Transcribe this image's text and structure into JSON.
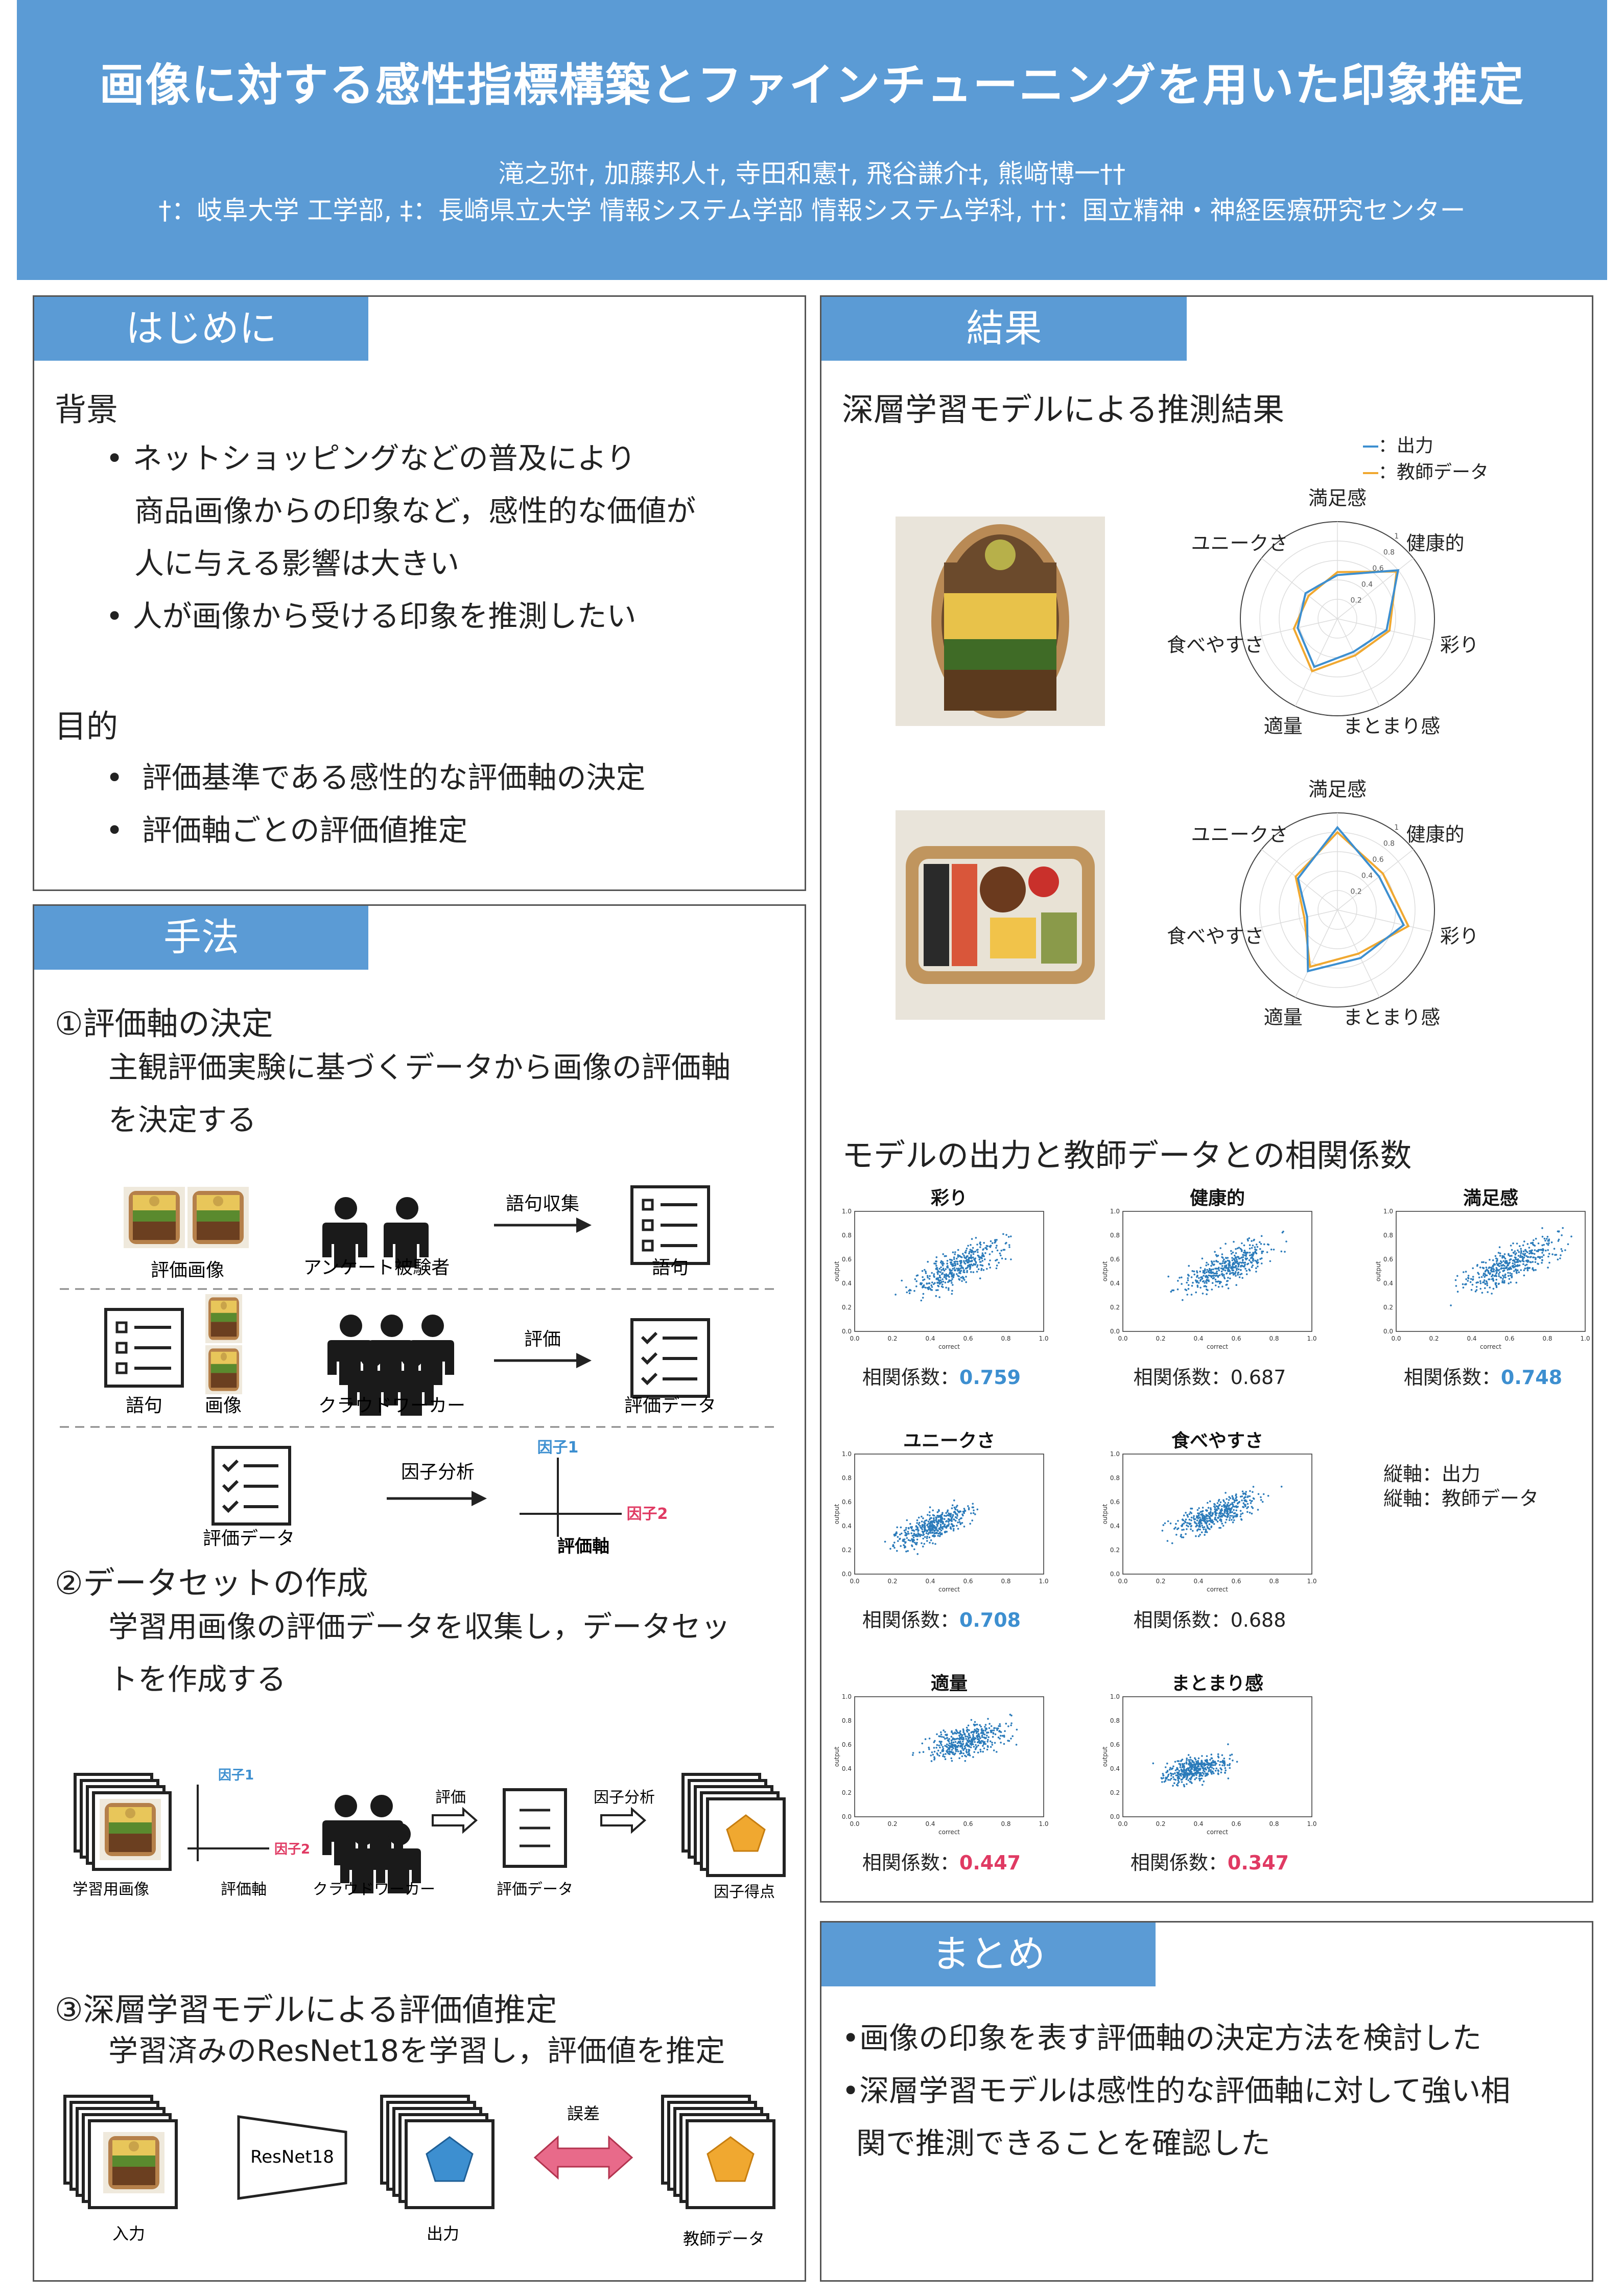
{
  "header": {
    "title": "画像に対する感性指標構築とファインチューニングを用いた印象推定",
    "authors": "滝之弥†, 加藤邦人†, 寺田和憲†, 飛谷謙介‡, 熊﨑博一††",
    "affiliations": "†：岐阜大学 工学部, ‡：長崎県立大学 情報システム学部 情報システム学科, ††：国立精神・神経医療研究センター"
  },
  "intro": {
    "tab": "はじめに",
    "bg_heading": "背景",
    "bg_bullets": [
      "ネットショッピングなどの普及により",
      "商品画像からの印象など，感性的な価値が",
      "人に与える影響は大きい",
      "人が画像から受ける印象を推測したい"
    ],
    "purpose_heading": "目的",
    "purpose_bullets": [
      "評価基準である感性的な評価軸の決定",
      "評価軸ごとの評価値推定"
    ]
  },
  "method": {
    "tab": "手法",
    "step1": {
      "heading": "①評価軸の決定",
      "text": [
        "主観評価実験に基づくデータから画像の評価軸",
        "を決定する"
      ]
    },
    "flow1": {
      "images": "評価画像",
      "respondents": "アンケート被験者",
      "collect": "語句収集",
      "words": "語句"
    },
    "flow2": {
      "words": "語句",
      "images": "画像",
      "crowd": "クラウドワーカー",
      "eval": "評価",
      "data": "評価データ"
    },
    "flow3": {
      "data": "評価データ",
      "fa": "因子分析",
      "f1": "因子1",
      "f2": "因子2",
      "axis": "評価軸"
    },
    "step2": {
      "heading": "②データセットの作成",
      "text": [
        "学習用画像の評価データを収集し，データセッ",
        "トを作成する"
      ]
    },
    "flow4": {
      "train": "学習用画像",
      "axis": "評価軸",
      "f1": "因子1",
      "f2": "因子2",
      "crowd": "クラウドワーカー",
      "eval": "評価",
      "data": "評価データ",
      "fa": "因子分析",
      "score": "因子得点"
    },
    "step3": {
      "heading": "③深層学習モデルによる評価値推定",
      "text": "学習済みのResNet18を学習し，評価値を推定"
    },
    "flow5": {
      "input": "入力",
      "model": "ResNet18",
      "output": "出力",
      "error": "誤差",
      "teacher": "教師データ"
    }
  },
  "results": {
    "tab": "結果",
    "radar_heading": "深層学習モデルによる推測結果",
    "legend": {
      "output": "：出力",
      "teacher": "：教師データ"
    },
    "colors": {
      "output": "#3d8fd0",
      "teacher": "#f0a830"
    },
    "radar_axes": [
      "満足感",
      "健康的",
      "彩り",
      "まとまり感",
      "適量",
      "食べやすさ",
      "ユニークさ"
    ],
    "corr_heading": "モデルの出力と教師データとの相関係数",
    "corr_prefix": "相関係数：",
    "axis_note": [
      "縦軸：出力",
      "縦軸：教師データ"
    ],
    "plot_xlabel": "correct",
    "plot_ylabel": "output",
    "plot_ticks": [
      "0.0",
      "0.2",
      "0.4",
      "0.6",
      "0.8",
      "1.0"
    ]
  },
  "chart_data": [
    {
      "type": "radar",
      "name": "lunchbox-1",
      "axes": [
        "満足感",
        "健康的",
        "彩り",
        "まとまり感",
        "適量",
        "食べやすさ",
        "ユニークさ"
      ],
      "rlim": [
        0,
        1
      ],
      "ticks": [
        "0.2",
        "0.4",
        "0.6",
        "0.8",
        "1"
      ],
      "series": [
        {
          "name": "出力",
          "values": [
            0.45,
            0.8,
            0.52,
            0.38,
            0.55,
            0.42,
            0.42
          ]
        },
        {
          "name": "教師データ",
          "values": [
            0.48,
            0.78,
            0.55,
            0.42,
            0.6,
            0.46,
            0.38
          ]
        }
      ]
    },
    {
      "type": "radar",
      "name": "lunchbox-2",
      "axes": [
        "満足感",
        "健康的",
        "彩り",
        "まとまり感",
        "適量",
        "食べやすさ",
        "ユニークさ"
      ],
      "rlim": [
        0,
        1
      ],
      "ticks": [
        "0.2",
        "0.4",
        "0.6",
        "0.8",
        "1"
      ],
      "series": [
        {
          "name": "出力",
          "values": [
            0.85,
            0.55,
            0.7,
            0.55,
            0.7,
            0.32,
            0.52
          ]
        },
        {
          "name": "教師データ",
          "values": [
            0.8,
            0.6,
            0.75,
            0.5,
            0.65,
            0.35,
            0.55
          ]
        }
      ]
    },
    {
      "type": "scatter",
      "title": "彩り",
      "xlabel": "correct",
      "ylabel": "output",
      "xlim": [
        0,
        1
      ],
      "ylim": [
        0,
        1
      ],
      "corr": "0.759",
      "highlight": "blue",
      "slope": 0.75,
      "intercept": 0.12,
      "spread": 0.1,
      "cx": 0.55,
      "sx": 0.17
    },
    {
      "type": "scatter",
      "title": "健康的",
      "xlabel": "correct",
      "ylabel": "output",
      "xlim": [
        0,
        1
      ],
      "ylim": [
        0,
        1
      ],
      "corr": "0.687",
      "highlight": "none",
      "slope": 0.65,
      "intercept": 0.18,
      "spread": 0.1,
      "cx": 0.55,
      "sx": 0.17
    },
    {
      "type": "scatter",
      "title": "満足感",
      "xlabel": "correct",
      "ylabel": "output",
      "xlim": [
        0,
        1
      ],
      "ylim": [
        0,
        1
      ],
      "corr": "0.748",
      "highlight": "blue",
      "slope": 0.72,
      "intercept": 0.12,
      "spread": 0.1,
      "cx": 0.6,
      "sx": 0.18
    },
    {
      "type": "scatter",
      "title": "ユニークさ",
      "xlabel": "correct",
      "ylabel": "output",
      "xlim": [
        0,
        1
      ],
      "ylim": [
        0,
        1
      ],
      "corr": "0.708",
      "highlight": "blue",
      "slope": 0.6,
      "intercept": 0.15,
      "spread": 0.08,
      "cx": 0.42,
      "sx": 0.14
    },
    {
      "type": "scatter",
      "title": "食べやすさ",
      "xlabel": "correct",
      "ylabel": "output",
      "xlim": [
        0,
        1
      ],
      "ylim": [
        0,
        1
      ],
      "corr": "0.688",
      "highlight": "none",
      "slope": 0.6,
      "intercept": 0.2,
      "spread": 0.09,
      "cx": 0.5,
      "sx": 0.16
    },
    {
      "type": "scatter",
      "title": "適量",
      "xlabel": "correct",
      "ylabel": "output",
      "xlim": [
        0,
        1
      ],
      "ylim": [
        0,
        1
      ],
      "corr": "0.447",
      "highlight": "pink",
      "slope": 0.35,
      "intercept": 0.42,
      "spread": 0.09,
      "cx": 0.6,
      "sx": 0.15
    },
    {
      "type": "scatter",
      "title": "まとまり感",
      "xlabel": "correct",
      "ylabel": "output",
      "xlim": [
        0,
        1
      ],
      "ylim": [
        0,
        1
      ],
      "corr": "0.347",
      "highlight": "pink",
      "slope": 0.3,
      "intercept": 0.28,
      "spread": 0.07,
      "cx": 0.38,
      "sx": 0.12
    }
  ],
  "summary": {
    "tab": "まとめ",
    "lines": [
      "•画像の印象を表す評価軸の決定方法を検討した",
      "•深層学習モデルは感性的な評価軸に対して強い相",
      "関で推測できることを確認した"
    ]
  }
}
